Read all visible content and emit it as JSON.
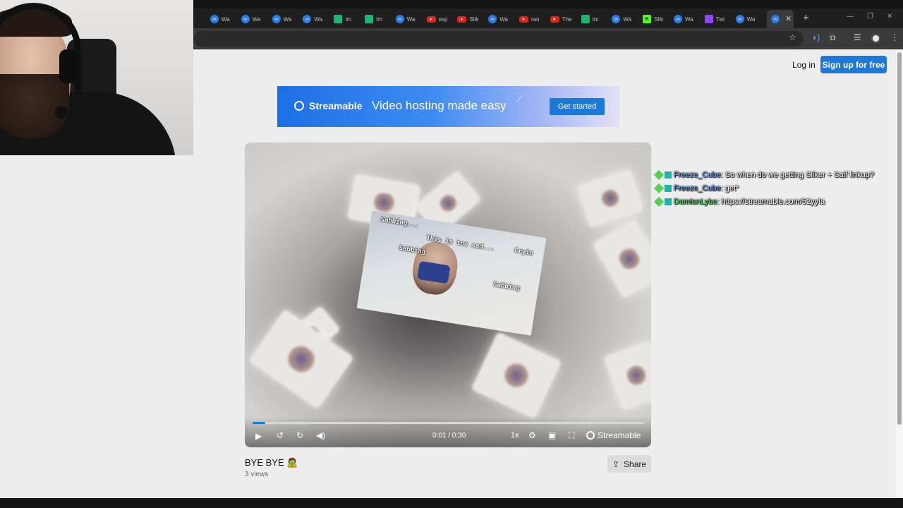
{
  "browser": {
    "tabs": [
      {
        "label": "Wa",
        "favicon": "streamable-icon",
        "kind": "streamable"
      },
      {
        "label": "Wa",
        "favicon": "streamable-icon",
        "kind": "streamable"
      },
      {
        "label": "Wa",
        "favicon": "streamable-icon",
        "kind": "streamable"
      },
      {
        "label": "Wa",
        "favicon": "streamable-icon",
        "kind": "streamable"
      },
      {
        "label": "Im",
        "favicon": "imgur-icon",
        "kind": "imgur"
      },
      {
        "label": "Im",
        "favicon": "imgur-icon",
        "kind": "imgur"
      },
      {
        "label": "Wa",
        "favicon": "streamable-icon",
        "kind": "streamable"
      },
      {
        "label": "exp",
        "favicon": "youtube-icon",
        "kind": "youtube"
      },
      {
        "label": "Slik",
        "favicon": "youtube-icon",
        "kind": "youtube"
      },
      {
        "label": "Wa",
        "favicon": "streamable-icon",
        "kind": "streamable"
      },
      {
        "label": "ran",
        "favicon": "youtube-icon",
        "kind": "youtube"
      },
      {
        "label": "The",
        "favicon": "youtube-icon",
        "kind": "youtube"
      },
      {
        "label": "Im",
        "favicon": "imgur-icon",
        "kind": "imgur"
      },
      {
        "label": "Wa",
        "favicon": "streamable-icon",
        "kind": "streamable"
      },
      {
        "label": "Slik",
        "favicon": "kick-icon",
        "kind": "kick"
      },
      {
        "label": "Wa",
        "favicon": "streamable-icon",
        "kind": "streamable"
      },
      {
        "label": "Twi",
        "favicon": "twitch-icon",
        "kind": "twitch"
      },
      {
        "label": "Wa",
        "favicon": "streamable-icon",
        "kind": "streamable"
      }
    ]
  },
  "site": {
    "login_label": "Log in",
    "signup_label": "Sign up for free"
  },
  "banner": {
    "brand": "Streamable",
    "headline": "Video hosting made easy",
    "cta": "Get started"
  },
  "player": {
    "time": "0:01 / 0:30",
    "speed": "1x",
    "brand": "Streamable",
    "progress": 0.033,
    "overlay_texts": [
      "Sabbing...",
      "This is too sad...",
      "Cryin",
      "Sabbing",
      "Sabbing"
    ]
  },
  "video": {
    "title": "BYE BYE 🧟",
    "views": "3 views",
    "share_label": "Share"
  },
  "chat": [
    {
      "user": "Freeze_Cube",
      "user_color": "#6d9fe8",
      "message": ": So when do we getting Sliker + Saif linkup?"
    },
    {
      "user": "Freeze_Cube",
      "user_color": "#6d9fe8",
      "message": ": get*"
    },
    {
      "user": "DamianLybe",
      "user_color": "#3fe05a",
      "message": ": https://streamable.com/52yyfa"
    }
  ]
}
